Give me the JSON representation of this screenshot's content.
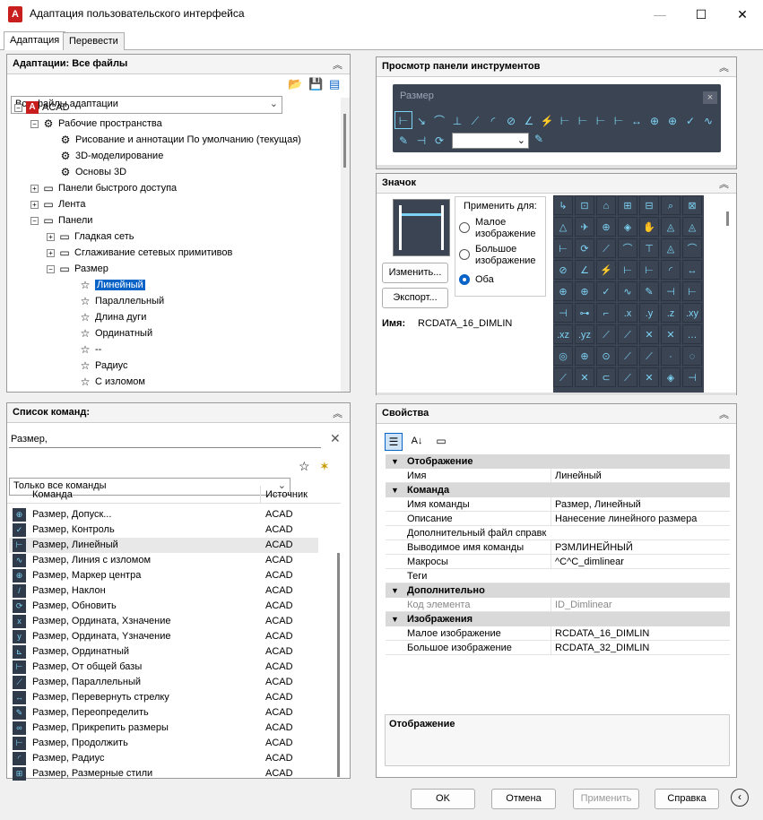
{
  "window": {
    "title": "Адаптация пользовательского интерфейса",
    "app_icon": "A"
  },
  "tabs": [
    {
      "label": "Адаптация"
    },
    {
      "label": "Перевести"
    }
  ],
  "customizations_panel": {
    "title": "Адаптации: Все файлы",
    "filter_value": "Все файлы адаптации",
    "tree": [
      {
        "label": "ACAD"
      },
      {
        "label": "Рабочие пространства"
      },
      {
        "label": "Рисование и аннотации По умолчанию (текущая)"
      },
      {
        "label": "3D-моделирование"
      },
      {
        "label": "Основы 3D"
      },
      {
        "label": "Панели быстрого доступа"
      },
      {
        "label": "Лента"
      },
      {
        "label": "Панели"
      },
      {
        "label": "Гладкая сеть"
      },
      {
        "label": "Сглаживание сетевых примитивов"
      },
      {
        "label": "Размер"
      },
      {
        "label": "Линейный"
      },
      {
        "label": "Параллельный"
      },
      {
        "label": "Длина дуги"
      },
      {
        "label": "Ординатный"
      },
      {
        "label": "--"
      },
      {
        "label": "Радиус"
      },
      {
        "label": "С изломом"
      }
    ]
  },
  "command_list": {
    "title": "Список команд:",
    "search_value": "Размер,",
    "filter_value": "Только все команды",
    "col_command": "Команда",
    "col_source": "Источник",
    "rows": [
      {
        "name": "Размер, Допуск...",
        "source": "ACAD",
        "icon": "⊕"
      },
      {
        "name": "Размер, Контроль",
        "source": "ACAD",
        "icon": "✓"
      },
      {
        "name": "Размер, Линейный",
        "source": "ACAD",
        "icon": "⊢"
      },
      {
        "name": "Размер, Линия с изломом",
        "source": "ACAD",
        "icon": "∿"
      },
      {
        "name": "Размер, Маркер центра",
        "source": "ACAD",
        "icon": "⊕"
      },
      {
        "name": "Размер, Наклон",
        "source": "ACAD",
        "icon": "/"
      },
      {
        "name": "Размер, Обновить",
        "source": "ACAD",
        "icon": "⟳"
      },
      {
        "name": "Размер, Ордината, Xзначение",
        "source": "ACAD",
        "icon": "x"
      },
      {
        "name": "Размер, Ордината, Yзначение",
        "source": "ACAD",
        "icon": "y"
      },
      {
        "name": "Размер, Ординатный",
        "source": "ACAD",
        "icon": "⊾"
      },
      {
        "name": "Размер, От общей базы",
        "source": "ACAD",
        "icon": "⊢"
      },
      {
        "name": "Размер, Параллельный",
        "source": "ACAD",
        "icon": "⟋"
      },
      {
        "name": "Размер, Перевернуть стрелку",
        "source": "ACAD",
        "icon": "↔"
      },
      {
        "name": "Размер, Переопределить",
        "source": "ACAD",
        "icon": "✎"
      },
      {
        "name": "Размер, Прикрепить размеры",
        "source": "ACAD",
        "icon": "∞"
      },
      {
        "name": "Размер, Продолжить",
        "source": "ACAD",
        "icon": "⊢"
      },
      {
        "name": "Размер, Радиус",
        "source": "ACAD",
        "icon": "◜"
      },
      {
        "name": "Размер, Размерные стили",
        "source": "ACAD",
        "icon": "⊞"
      }
    ]
  },
  "toolbar_preview": {
    "title": "Просмотр панели инструментов",
    "toolbar_name": "Размер",
    "close_glyph": "×",
    "icons_row1": [
      "⊢",
      "↘",
      "⌒",
      "⊥",
      "⟋",
      "◜",
      "⊘",
      "∠",
      "⚡",
      "⊢",
      "⊢",
      "⊢",
      "⊢",
      "↔",
      "⊕",
      "⊕",
      "✓",
      "∿"
    ],
    "icons_row2": [
      "✎",
      "⊣",
      "⟳"
    ]
  },
  "image_panel": {
    "title": "Значок",
    "apply_for_label": "Применить для:",
    "radio_small": "Малое изображение",
    "radio_large": "Большое изображение",
    "radio_both": "Оба",
    "edit_button": "Изменить...",
    "export_button": "Экспорт...",
    "name_label": "Имя:",
    "name_value": "RCDATA_16_DIMLIN",
    "icon_grid": [
      "↳",
      "⊡",
      "⌂",
      "⊞",
      "⊟",
      "⌕",
      "⊠",
      "△",
      "✈",
      "⊕",
      "◈",
      "✋",
      "◬",
      "◬",
      "⊢",
      "⟳",
      "⟋",
      "⌒",
      "⊤",
      "◬",
      "⌒",
      "⊘",
      "∠",
      "⚡",
      "⊢",
      "⊢",
      "◜",
      "↔",
      "⊕",
      "⊕",
      "✓",
      "∿",
      "✎",
      "⊣",
      "⊢",
      "⊣",
      "⊶",
      "⌐",
      ".x",
      ".y",
      ".z",
      ".xy",
      ".xz",
      ".yz",
      "⟋",
      "⟋",
      "✕",
      "✕",
      "…",
      "◎",
      "⊕",
      "⊙",
      "⟋",
      "⟋",
      "·",
      "◌",
      "⟋",
      "✕",
      "⊂",
      "⟋",
      "✕",
      "◈",
      "⊣"
    ]
  },
  "properties": {
    "title": "Свойства",
    "categories": [
      {
        "name": "Отображение",
        "rows": [
          {
            "k": "Имя",
            "v": "Линейный"
          }
        ]
      },
      {
        "name": "Команда",
        "rows": [
          {
            "k": "Имя команды",
            "v": "Размер, Линейный"
          },
          {
            "k": "Описание",
            "v": "Нанесение линейного размера"
          },
          {
            "k": "Дополнительный файл справки",
            "v": ""
          },
          {
            "k": "Выводимое имя команды",
            "v": "РЗМЛИНЕЙНЫЙ"
          },
          {
            "k": "Макросы",
            "v": "^C^C_dimlinear"
          },
          {
            "k": "Теги",
            "v": ""
          }
        ]
      },
      {
        "name": "Дополнительно",
        "rows": [
          {
            "k": "Код элемента",
            "v": "ID_Dimlinear"
          }
        ]
      },
      {
        "name": "Изображения",
        "rows": [
          {
            "k": "Малое изображение",
            "v": "RCDATA_16_DIMLIN"
          },
          {
            "k": "Большое изображение",
            "v": "RCDATA_32_DIMLIN"
          }
        ]
      }
    ],
    "description_title": "Отображение"
  },
  "footer": {
    "ok": "OK",
    "cancel": "Отмена",
    "apply": "Применить",
    "help": "Справка"
  }
}
